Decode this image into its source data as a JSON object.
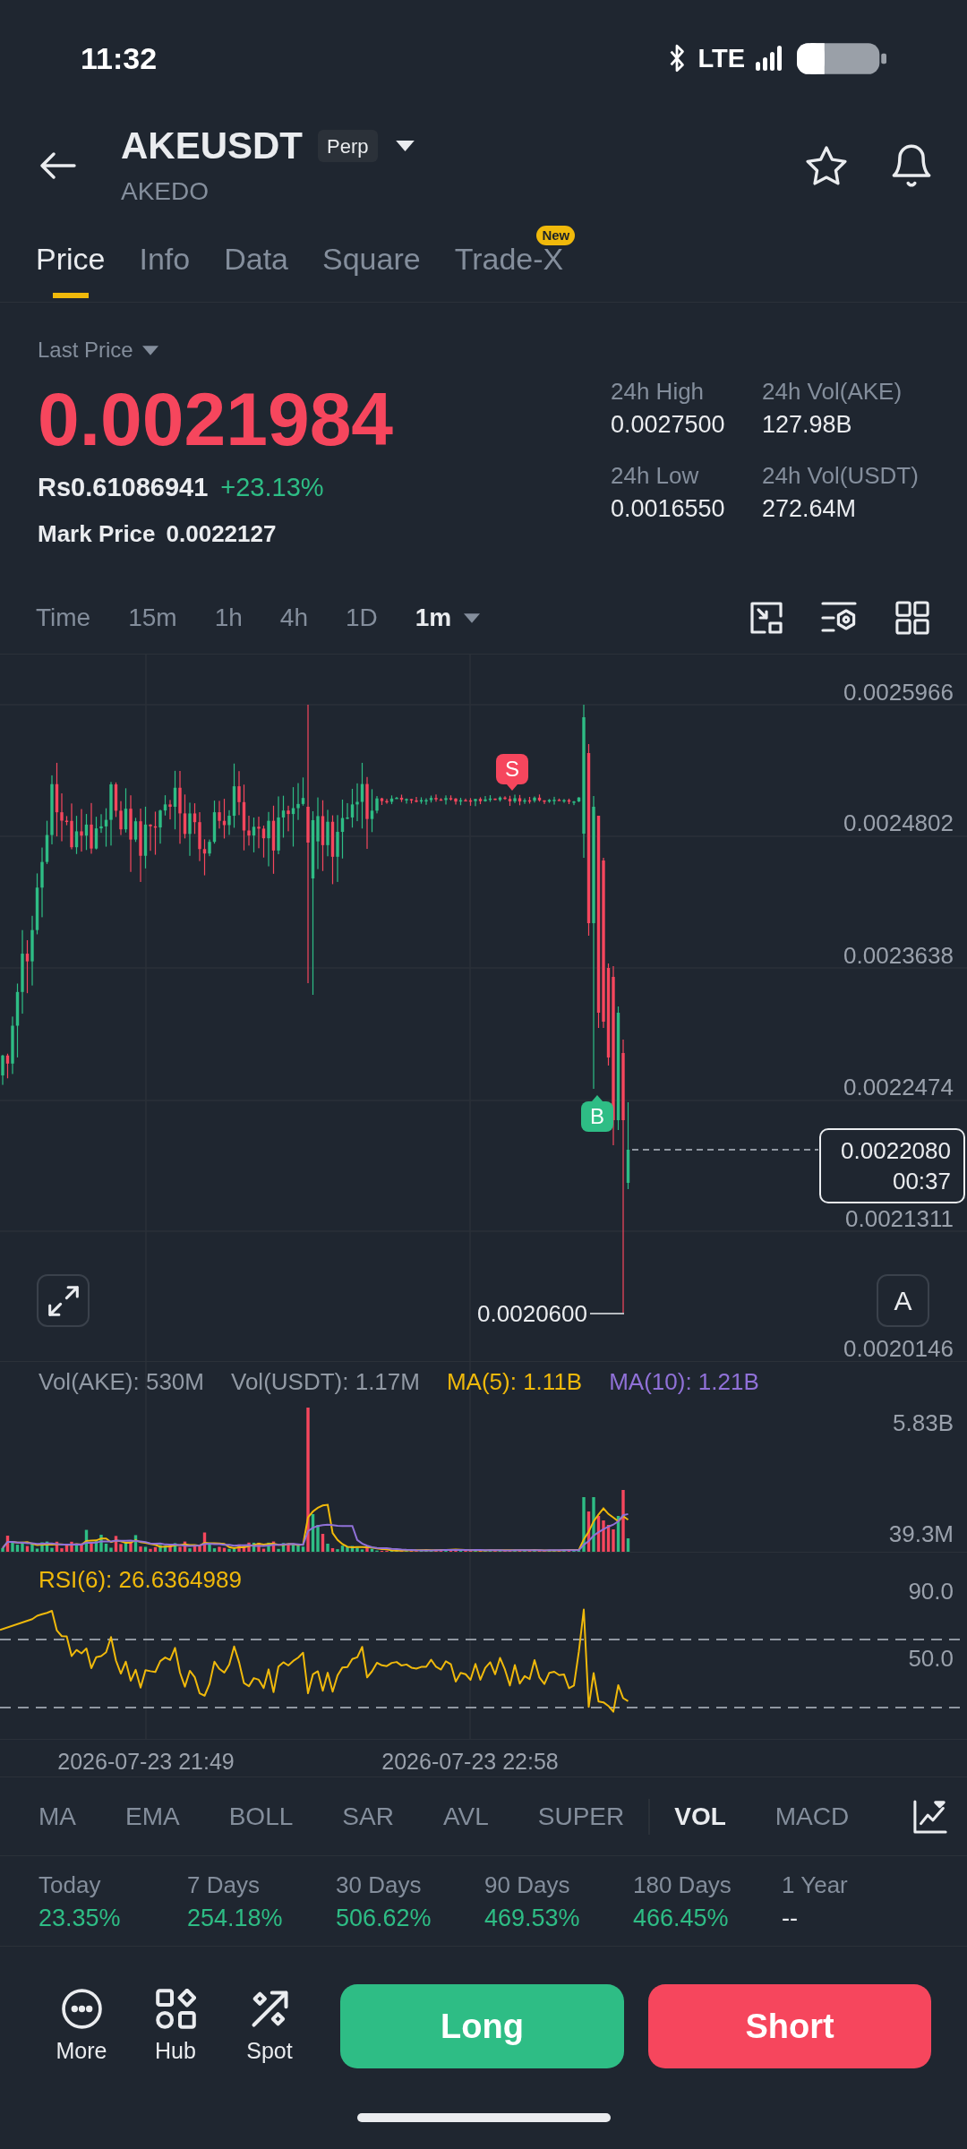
{
  "status_bar": {
    "time": "11:32",
    "network": "LTE"
  },
  "header": {
    "symbol": "AKEUSDT",
    "badge": "Perp",
    "subtitle": "AKEDO",
    "favorite": false
  },
  "tabs": [
    {
      "label": "Price",
      "selected": true
    },
    {
      "label": "Info",
      "selected": false
    },
    {
      "label": "Data",
      "selected": false
    },
    {
      "label": "Square",
      "selected": false
    },
    {
      "label": "Trade-X",
      "selected": false,
      "badge": "New"
    }
  ],
  "price": {
    "selector": "Last Price",
    "last_price": "0.0021984",
    "last_price_falling": true,
    "fiat_price": "Rs0.61086941",
    "change": "+23.13%",
    "change_rising": true,
    "mark_label": "Mark Price",
    "mark_price": "0.0022127"
  },
  "stats": [
    {
      "label": "24h High",
      "value": "0.0027500"
    },
    {
      "label": "24h Vol(AKE)",
      "value": "127.98B"
    },
    {
      "label": "24h Low",
      "value": "0.0016550"
    },
    {
      "label": "24h Vol(USDT)",
      "value": "272.64M"
    }
  ],
  "intervals": [
    {
      "label": "Time",
      "selected": false,
      "dropdown": false
    },
    {
      "label": "15m",
      "selected": false,
      "dropdown": false
    },
    {
      "label": "1h",
      "selected": false,
      "dropdown": false
    },
    {
      "label": "4h",
      "selected": false,
      "dropdown": false
    },
    {
      "label": "1D",
      "selected": false,
      "dropdown": false
    },
    {
      "label": "1m",
      "selected": true,
      "dropdown": true
    }
  ],
  "chart": {
    "price_axis": [
      "0.0025966",
      "0.0024802",
      "0.0023638",
      "0.0022474",
      "0.0021311",
      "0.0020146"
    ],
    "last_price": "0.0022080",
    "countdown": "00:37",
    "low_price": "0.0020600",
    "markers": [
      {
        "kind": "sell",
        "label": "S"
      },
      {
        "kind": "buy",
        "label": "B"
      }
    ],
    "scale_button": "A"
  },
  "volume": {
    "legend": [
      {
        "label": "Vol(AKE): 530M",
        "color": "#929aa5"
      },
      {
        "label": "Vol(USDT): 1.17M",
        "color": "#929aa5"
      },
      {
        "label": "MA(5): 1.11B",
        "color": "#f0b90b"
      },
      {
        "label": "MA(10): 1.21B",
        "color": "#9071d8"
      }
    ],
    "axis": [
      "5.83B",
      "39.3M"
    ]
  },
  "rsi": {
    "legend": "RSI(6): 26.6364989",
    "axis": [
      "90.0",
      "50.0"
    ]
  },
  "time_axis": [
    "2026-07-23 21:49",
    "2026-07-23 22:58"
  ],
  "indicators": {
    "main": [
      {
        "label": "MA",
        "selected": false
      },
      {
        "label": "EMA",
        "selected": false
      },
      {
        "label": "BOLL",
        "selected": false
      },
      {
        "label": "SAR",
        "selected": false
      },
      {
        "label": "AVL",
        "selected": false
      },
      {
        "label": "SUPER",
        "selected": false
      }
    ],
    "sub": [
      {
        "label": "VOL",
        "selected": true
      },
      {
        "label": "MACD",
        "selected": false
      }
    ]
  },
  "returns": [
    {
      "label": "Today",
      "value": "23.35%",
      "color": "#2ebd85"
    },
    {
      "label": "7 Days",
      "value": "254.18%",
      "color": "#2ebd85"
    },
    {
      "label": "30 Days",
      "value": "506.62%",
      "color": "#2ebd85"
    },
    {
      "label": "90 Days",
      "value": "469.53%",
      "color": "#2ebd85"
    },
    {
      "label": "180 Days",
      "value": "466.45%",
      "color": "#2ebd85"
    },
    {
      "label": "1 Year",
      "value": "--",
      "color": "#eaecef"
    }
  ],
  "actions": [
    {
      "label": "More"
    },
    {
      "label": "Hub"
    },
    {
      "label": "Spot"
    }
  ],
  "trade_buttons": [
    {
      "kind": "long",
      "label": "Long"
    },
    {
      "kind": "short",
      "label": "Short"
    }
  ]
}
